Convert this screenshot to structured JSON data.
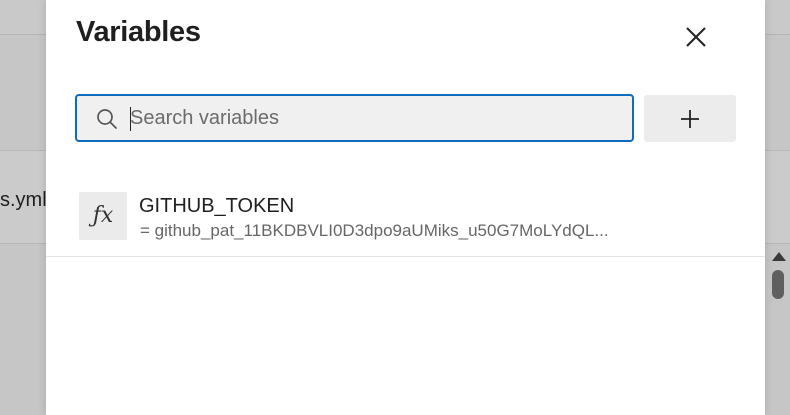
{
  "background": {
    "file_label": "s.yml"
  },
  "dialog": {
    "title": "Variables",
    "search": {
      "placeholder": "Search variables",
      "value": ""
    },
    "variables": [
      {
        "name": "GITHUB_TOKEN",
        "value": "= github_pat_11BKDBVLI0D3dpo9aUMiks_u50G7MoLYdQL...",
        "icon": "fx-icon"
      }
    ]
  },
  "colors": {
    "accent": "#0f6cbd"
  }
}
